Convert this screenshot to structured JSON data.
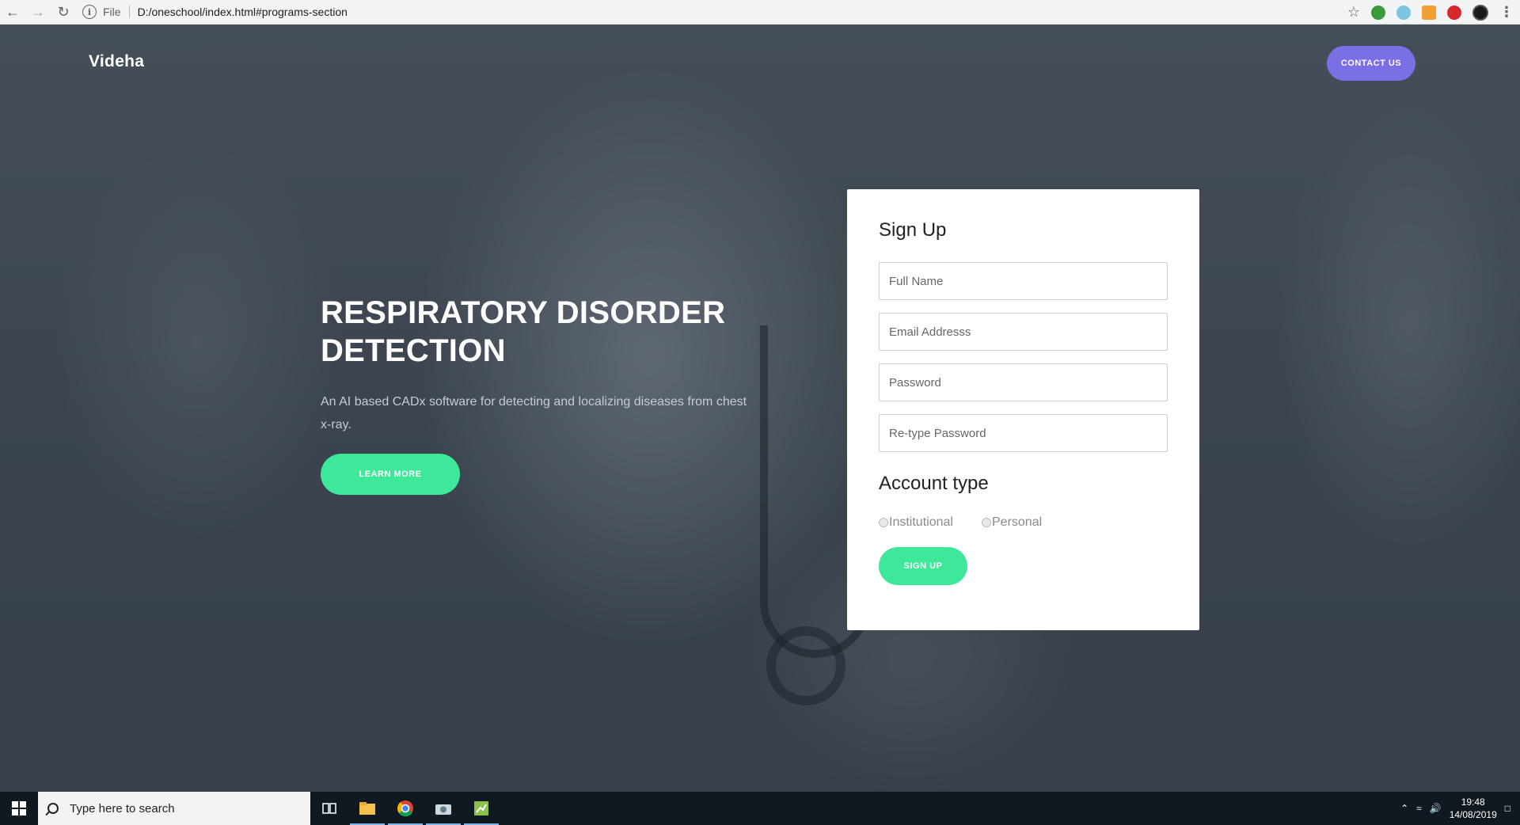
{
  "browser": {
    "url_prefix": "File",
    "url": "D:/oneschool/index.html#programs-section"
  },
  "nav": {
    "brand": "Videha",
    "contact_label": "CONTACT US"
  },
  "hero": {
    "title": "RESPIRATORY DISORDER DETECTION",
    "subtitle": "An AI based CADx software for detecting and localizing diseases from chest x-ray.",
    "learn_more_label": "LEARN MORE"
  },
  "signup": {
    "title": "Sign Up",
    "full_name_placeholder": "Full Name",
    "email_placeholder": "Email Addresss",
    "password_placeholder": "Password",
    "retype_placeholder": "Re-type Password",
    "account_type_title": "Account type",
    "options": [
      "Institutional",
      "Personal"
    ],
    "submit_label": "SIGN UP"
  },
  "taskbar": {
    "search_placeholder": "Type here to search",
    "time": "19:48",
    "date": "14/08/2019"
  },
  "colors": {
    "accent_green": "#3ee89a",
    "accent_purple": "#7a6fe4"
  }
}
